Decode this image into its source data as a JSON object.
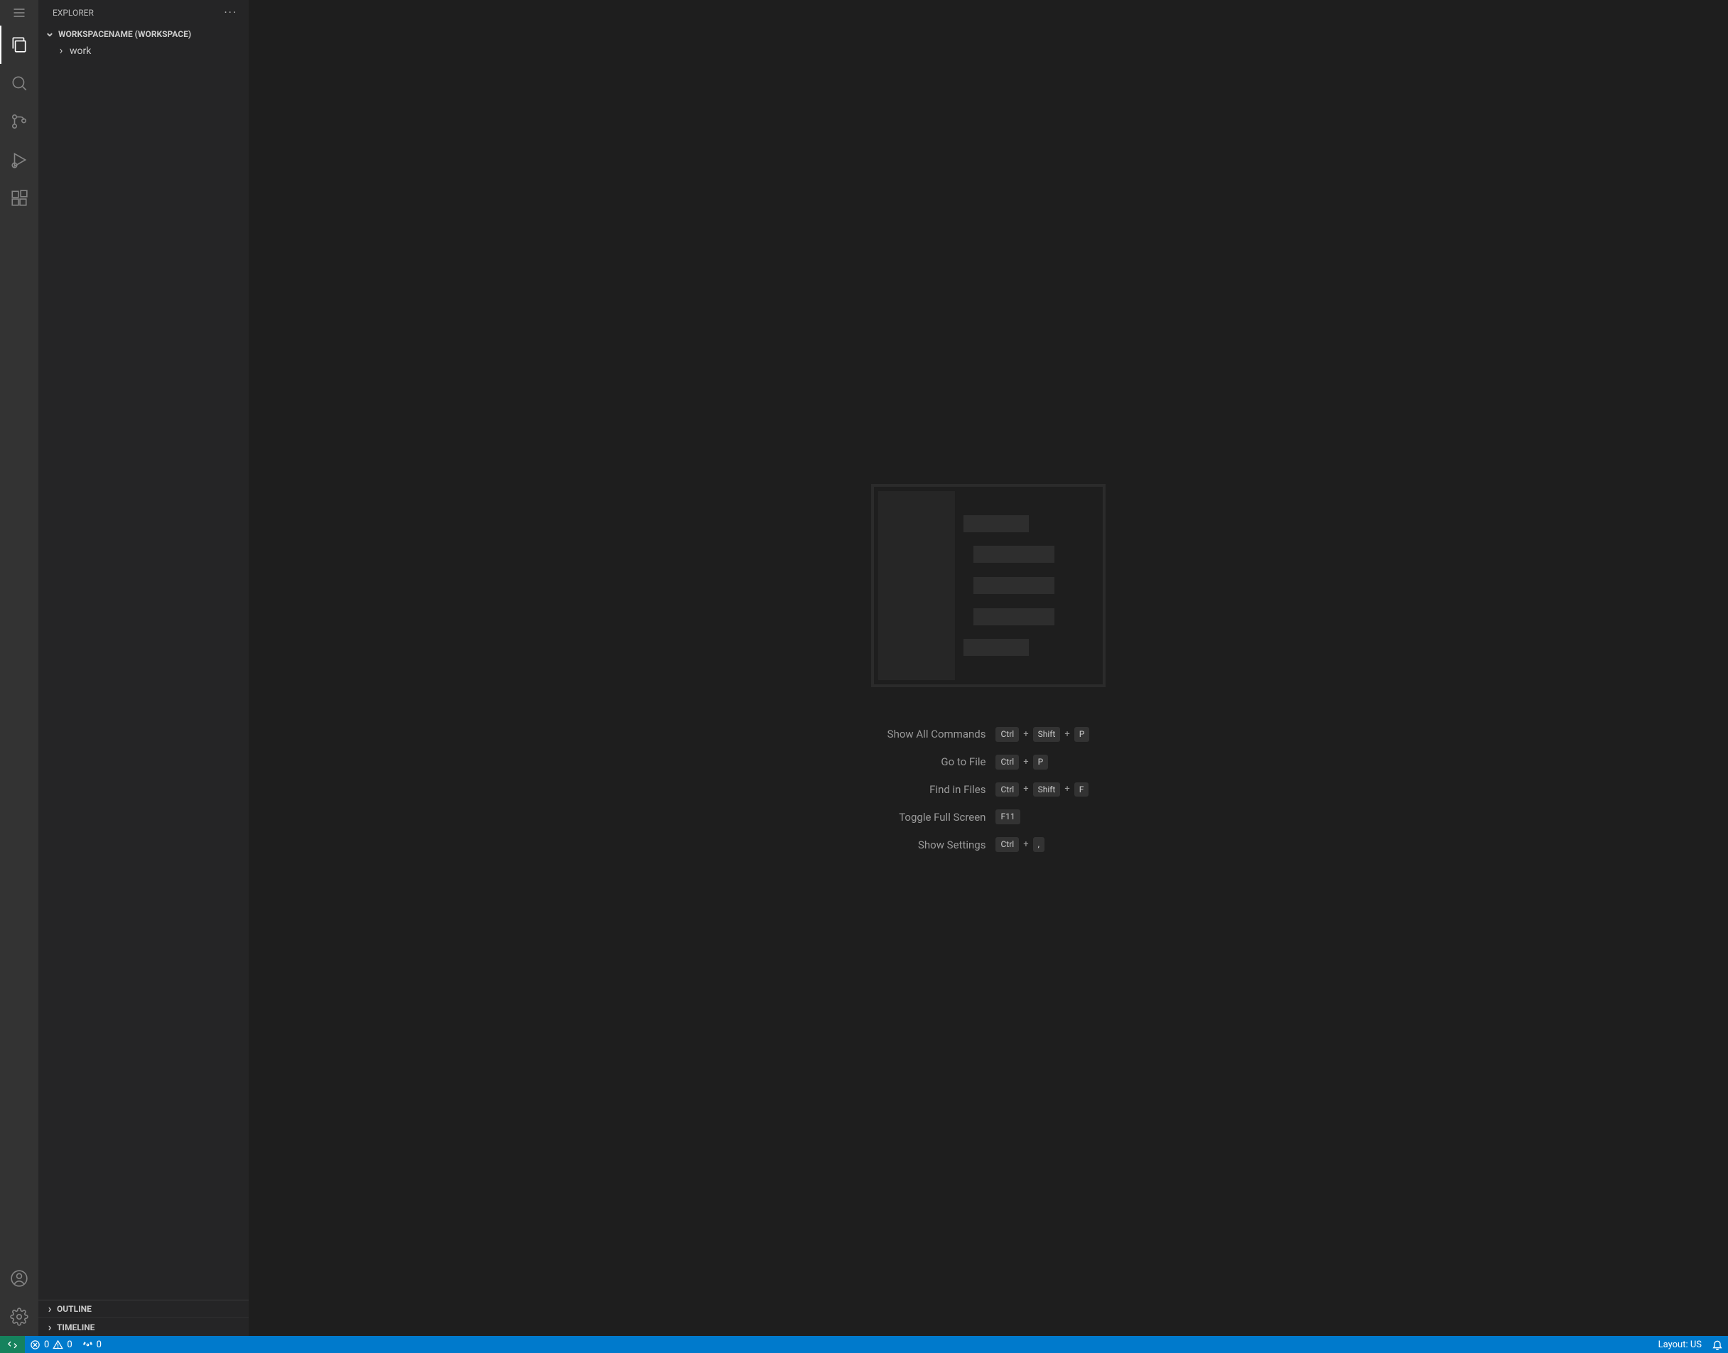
{
  "sidebar": {
    "title": "EXPLORER",
    "workspace": {
      "label": "WORKSPACENAME (WORKSPACE)"
    },
    "tree": {
      "items": [
        {
          "label": "work"
        }
      ]
    },
    "sections": {
      "outline": "OUTLINE",
      "timeline": "TIMELINE"
    }
  },
  "activitybar": {
    "items": [
      "explorer",
      "search",
      "source-control",
      "run-debug",
      "extensions",
      "accounts",
      "manage"
    ]
  },
  "welcome": {
    "shortcuts": [
      {
        "label": "Show All Commands",
        "keys": [
          "Ctrl",
          "Shift",
          "P"
        ]
      },
      {
        "label": "Go to File",
        "keys": [
          "Ctrl",
          "P"
        ]
      },
      {
        "label": "Find in Files",
        "keys": [
          "Ctrl",
          "Shift",
          "F"
        ]
      },
      {
        "label": "Toggle Full Screen",
        "keys": [
          "F11"
        ]
      },
      {
        "label": "Show Settings",
        "keys": [
          "Ctrl",
          ","
        ]
      }
    ]
  },
  "statusbar": {
    "errors": "0",
    "warnings": "0",
    "ports": "0",
    "layout": "Layout: US"
  }
}
